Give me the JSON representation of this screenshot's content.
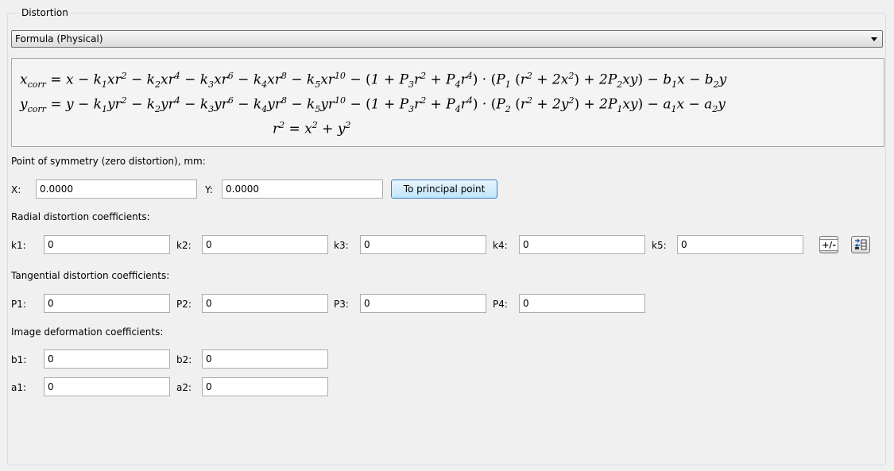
{
  "group": {
    "title": "Distortion"
  },
  "model_select": {
    "selected": "Formula (Physical)"
  },
  "symmetry": {
    "label": "Point of symmetry (zero distortion), mm:",
    "x_label": "X:",
    "x_value": "0.0000",
    "y_label": "Y:",
    "y_value": "0.0000",
    "principal_button": "To principal point"
  },
  "radial": {
    "label": "Radial distortion coefficients:",
    "fields": [
      {
        "label": "k1:",
        "value": "0"
      },
      {
        "label": "k2:",
        "value": "0"
      },
      {
        "label": "k3:",
        "value": "0"
      },
      {
        "label": "k4:",
        "value": "0"
      },
      {
        "label": "k5:",
        "value": "0"
      }
    ],
    "sign_button": "+/-",
    "icons": [
      "plus-minus-icon",
      "swap-columns-icon"
    ]
  },
  "tangential": {
    "label": "Tangential distortion coefficients:",
    "fields": [
      {
        "label": "P1:",
        "value": "0"
      },
      {
        "label": "P2:",
        "value": "0"
      },
      {
        "label": "P3:",
        "value": "0"
      },
      {
        "label": "P4:",
        "value": "0"
      }
    ]
  },
  "deformation": {
    "label": "Image deformation coefficients:",
    "fields": [
      {
        "label": "b1:",
        "value": "0"
      },
      {
        "label": "b2:",
        "value": "0"
      },
      {
        "label": "a1:",
        "value": "0"
      },
      {
        "label": "a2:",
        "value": "0"
      }
    ]
  },
  "colors": {
    "background": "#f0f0f0",
    "group_border": "#d5dfe5",
    "button_highlight": "#3c7fb1",
    "input_border": "#abadb3"
  }
}
